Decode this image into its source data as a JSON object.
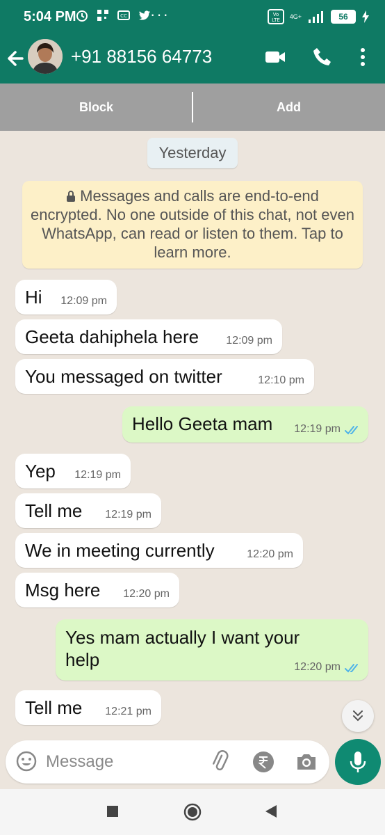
{
  "status_bar": {
    "time": "5:04 PM",
    "network": "4G+",
    "battery": "56"
  },
  "header": {
    "contact": "+91 88156 64773"
  },
  "action_bar": {
    "block_label": "Block",
    "add_label": "Add"
  },
  "chat": {
    "date_divider": "Yesterday",
    "encryption_notice": "Messages and calls are end-to-end encrypted. No one outside of this chat, not even WhatsApp, can read or listen to them. Tap to learn more.",
    "messages": [
      {
        "direction": "in",
        "text": "Hi",
        "time": "12:09 pm"
      },
      {
        "direction": "in",
        "text": "Geeta dahiphela here",
        "time": "12:09 pm"
      },
      {
        "direction": "in",
        "text": "You messaged on twitter",
        "time": "12:10 pm"
      },
      {
        "direction": "out",
        "text": "Hello Geeta mam",
        "time": "12:19 pm",
        "status": "read"
      },
      {
        "direction": "in",
        "text": "Yep",
        "time": "12:19 pm"
      },
      {
        "direction": "in",
        "text": "Tell me",
        "time": "12:19 pm"
      },
      {
        "direction": "in",
        "text": "We in meeting currently",
        "time": "12:20 pm"
      },
      {
        "direction": "in",
        "text": "Msg here",
        "time": "12:20 pm"
      },
      {
        "direction": "out",
        "text_line1": "Yes mam actually I want your",
        "text_line2": "help",
        "time": "12:20 pm",
        "status": "read"
      },
      {
        "direction": "in",
        "text": "Tell me",
        "time": "12:21 pm"
      }
    ]
  },
  "composer": {
    "placeholder": "Message"
  },
  "colors": {
    "header": "#0f7a64",
    "outgoing": "#dcf8c6",
    "incoming": "#ffffff",
    "chat_bg": "#ece5dd",
    "read_ticks": "#4fb3e8"
  },
  "icons": [
    "back-arrow-icon",
    "video-call-icon",
    "phone-icon",
    "more-options-icon",
    "lock-icon",
    "double-check-icon",
    "chevrons-down-icon",
    "emoji-icon",
    "attach-icon",
    "rupee-icon",
    "camera-icon",
    "mic-icon",
    "recents-icon",
    "home-icon",
    "back-icon"
  ]
}
